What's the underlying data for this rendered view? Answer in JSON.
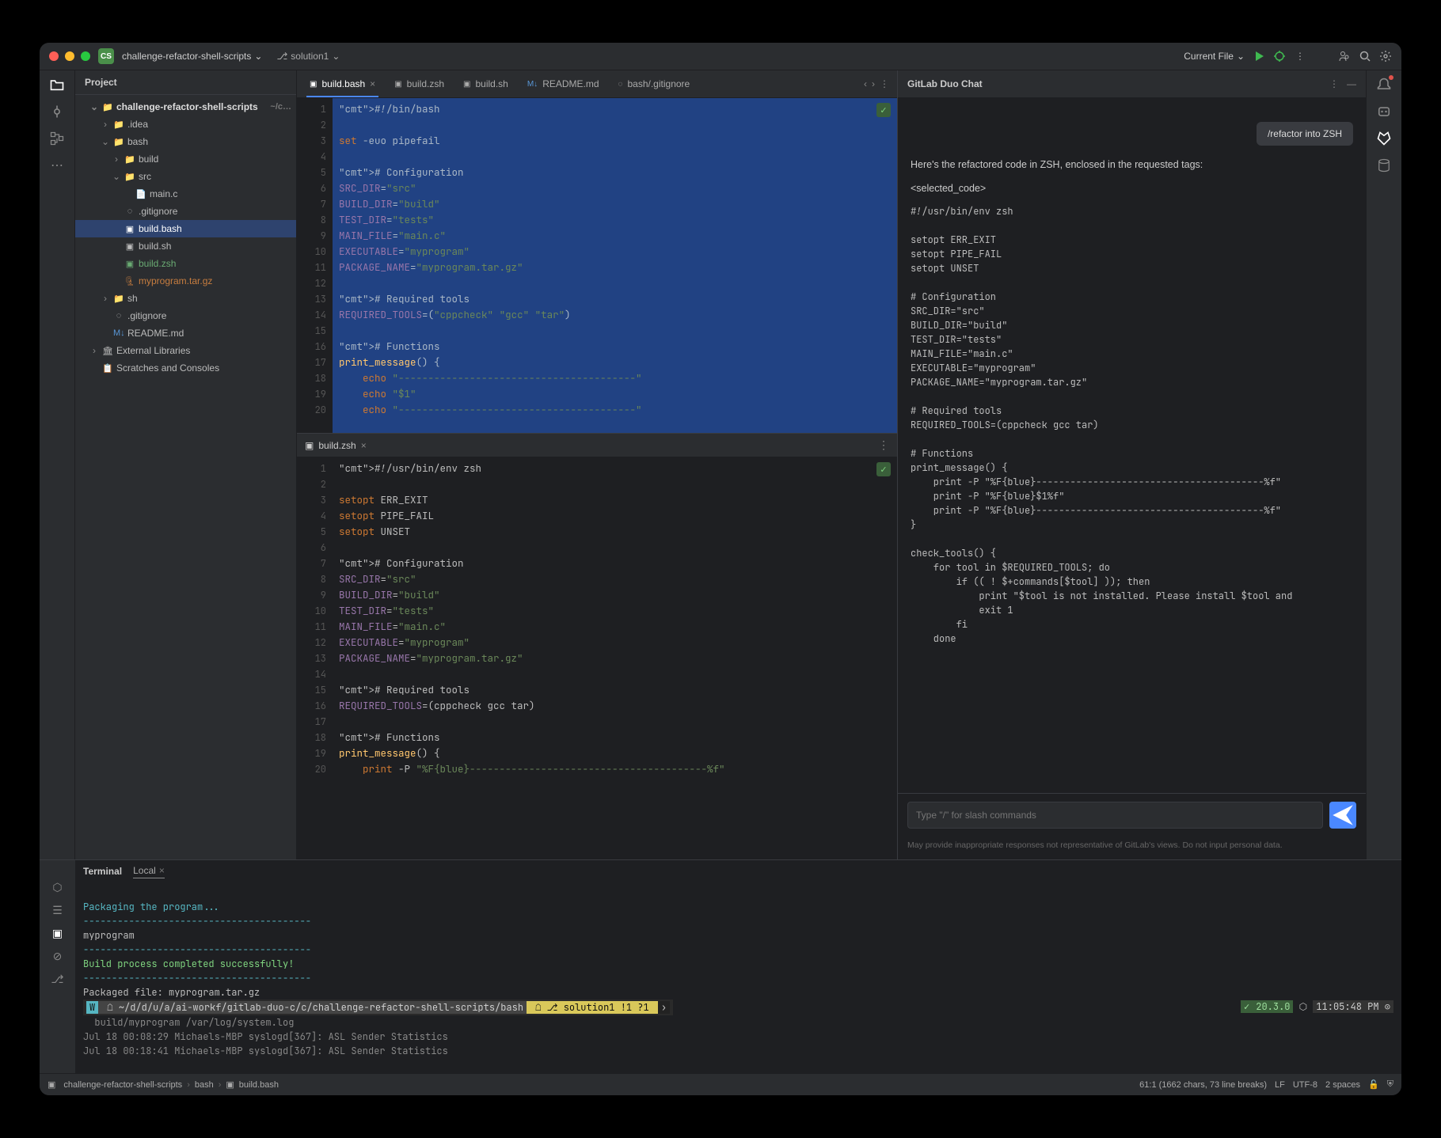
{
  "titlebar": {
    "project_badge": "CS",
    "project_name": "challenge-refactor-shell-scripts",
    "branch": "solution1",
    "run_config": "Current File"
  },
  "project_panel": {
    "header": "Project",
    "root": {
      "name": "challenge-refactor-shell-scripts",
      "suffix": "~/c…"
    },
    "tree": {
      "idea": ".idea",
      "bash": "bash",
      "build": "build",
      "src": "src",
      "main_c": "main.c",
      "gitignore": ".gitignore",
      "build_bash": "build.bash",
      "build_sh": "build.sh",
      "build_zsh": "build.zsh",
      "package": "myprogram.tar.gz",
      "sh": "sh",
      "root_gitignore": ".gitignore",
      "readme": "README.md",
      "ext_libs": "External Libraries",
      "scratches": "Scratches and Consoles"
    }
  },
  "tabs": [
    {
      "icon": "sh",
      "label": "build.bash",
      "active": true,
      "close": true
    },
    {
      "icon": "sh",
      "label": "build.zsh",
      "active": false
    },
    {
      "icon": "sh",
      "label": "build.sh",
      "active": false
    },
    {
      "icon": "md",
      "label": "README.md",
      "active": false
    },
    {
      "icon": "git",
      "label": "bash/.gitignore",
      "active": false
    }
  ],
  "editor_top": {
    "filename": "build.bash",
    "lines": [
      "#!/bin/bash",
      "",
      "set -euo pipefail",
      "",
      "# Configuration",
      "SRC_DIR=\"src\"",
      "BUILD_DIR=\"build\"",
      "TEST_DIR=\"tests\"",
      "MAIN_FILE=\"main.c\"",
      "EXECUTABLE=\"myprogram\"",
      "PACKAGE_NAME=\"myprogram.tar.gz\"",
      "",
      "# Required tools",
      "REQUIRED_TOOLS=(\"cppcheck\" \"gcc\" \"tar\")",
      "",
      "# Functions",
      "print_message() {",
      "    echo \"----------------------------------------\"",
      "    echo \"$1\"",
      "    echo \"----------------------------------------\""
    ]
  },
  "editor_bottom": {
    "filename": "build.zsh",
    "lines": [
      "#!/usr/bin/env zsh",
      "",
      "setopt ERR_EXIT",
      "setopt PIPE_FAIL",
      "setopt UNSET",
      "",
      "# Configuration",
      "SRC_DIR=\"src\"",
      "BUILD_DIR=\"build\"",
      "TEST_DIR=\"tests\"",
      "MAIN_FILE=\"main.c\"",
      "EXECUTABLE=\"myprogram\"",
      "PACKAGE_NAME=\"myprogram.tar.gz\"",
      "",
      "# Required tools",
      "REQUIRED_TOOLS=(cppcheck gcc tar)",
      "",
      "# Functions",
      "print_message() {",
      "    print -P \"%F{blue}----------------------------------------%f\""
    ]
  },
  "chat": {
    "title": "GitLab Duo Chat",
    "hint": "",
    "user_message": "/refactor into ZSH",
    "response_intro": "Here's the refactored code in ZSH, enclosed in the requested tags:",
    "tag_open": "<selected_code>",
    "code": "#!/usr/bin/env zsh\n\nsetopt ERR_EXIT\nsetopt PIPE_FAIL\nsetopt UNSET\n\n# Configuration\nSRC_DIR=\"src\"\nBUILD_DIR=\"build\"\nTEST_DIR=\"tests\"\nMAIN_FILE=\"main.c\"\nEXECUTABLE=\"myprogram\"\nPACKAGE_NAME=\"myprogram.tar.gz\"\n\n# Required tools\nREQUIRED_TOOLS=(cppcheck gcc tar)\n\n# Functions\nprint_message() {\n    print -P \"%F{blue}----------------------------------------%f\"\n    print -P \"%F{blue}$1%f\"\n    print -P \"%F{blue}----------------------------------------%f\"\n}\n\ncheck_tools() {\n    for tool in $REQUIRED_TOOLS; do\n        if (( ! $+commands[$tool] )); then\n            print \"$tool is not installed. Please install $tool and\n            exit 1\n        fi\n    done",
    "input_placeholder": "Type \"/\" for slash commands",
    "footer": "May provide inappropriate responses not representative of GitLab's views. Do not input personal data."
  },
  "terminal": {
    "tab_main": "Terminal",
    "tab_sub": "Local",
    "lines": {
      "l1": "Packaging the program...",
      "l2": "----------------------------------------",
      "l3": "myprogram",
      "l4": "----------------------------------------",
      "l5": "Build process completed successfully!",
      "l6": "----------------------------------------",
      "l7": "Packaged file: myprogram.tar.gz"
    },
    "prompt_path": "~/d/d/u/a/ai-workf/gitlab-duo-c/c/challenge-refactor-shell-scripts/bash",
    "prompt_branch": "solution1 !1 ?1",
    "node_version": "20.3.0",
    "time": "11:05:48 PM",
    "line_below": "build/myprogram /var/log/system.log",
    "syslog1": "Jul 18 00:08:29 Michaels-MBP syslogd[367]: ASL Sender Statistics",
    "syslog2": "Jul 18 00:18:41 Michaels-MBP syslogd[367]: ASL Sender Statistics"
  },
  "statusbar": {
    "crumb1": "challenge-refactor-shell-scripts",
    "crumb2": "bash",
    "crumb3": "build.bash",
    "position": "61:1 (1662 chars, 73 line breaks)",
    "line_sep": "LF",
    "encoding": "UTF-8",
    "indent": "2 spaces"
  }
}
